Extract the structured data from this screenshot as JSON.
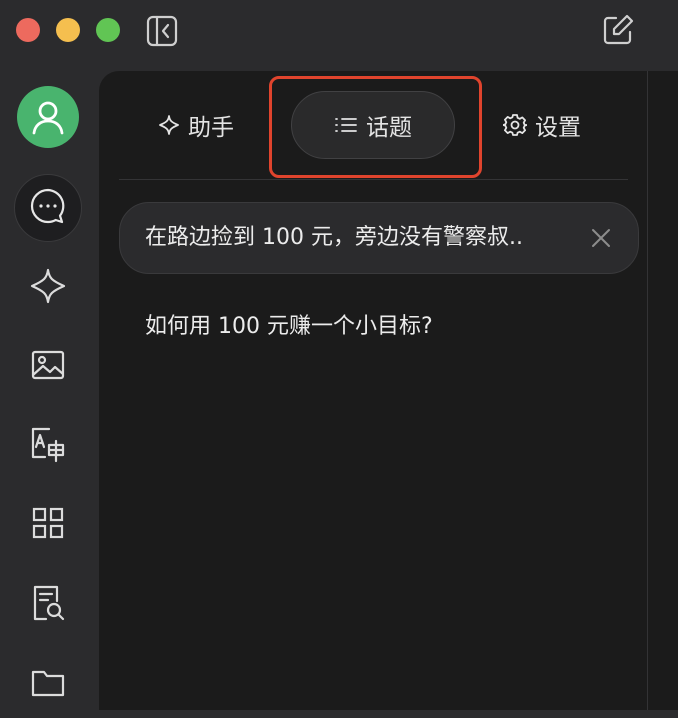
{
  "window": {
    "controls": [
      "close",
      "minimize",
      "zoom"
    ],
    "icons": [
      "sidebar-toggle-icon",
      "compose-icon"
    ]
  },
  "sidebar": {
    "avatar_icon": "user-icon",
    "items": [
      {
        "name": "chat",
        "icon": "chat-bubble-icon",
        "active": true
      },
      {
        "name": "agents",
        "icon": "sparkle-icon"
      },
      {
        "name": "images",
        "icon": "image-icon"
      },
      {
        "name": "translate",
        "icon": "translate-icon"
      },
      {
        "name": "apps",
        "icon": "grid-icon"
      },
      {
        "name": "knowledge",
        "icon": "document-search-icon"
      },
      {
        "name": "files",
        "icon": "folder-icon"
      }
    ]
  },
  "tabs": {
    "assistant_label": "助手",
    "topics_label": "话题",
    "settings_label": "设置",
    "active": "topics"
  },
  "topics": {
    "items": [
      {
        "title": "在路边捡到 100 元，旁边没有警察叔..",
        "selected": true
      },
      {
        "title": "如何用 100 元赚一个小目标?",
        "selected": false
      }
    ]
  },
  "colors": {
    "highlight": "#e0442d",
    "avatar_bg": "#49b46e"
  }
}
